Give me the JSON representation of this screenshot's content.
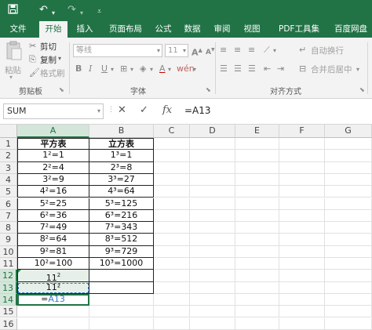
{
  "title_bar": {
    "save_icon": "save-icon",
    "undo_icon": "undo-icon",
    "redo_icon": "redo-icon",
    "qat_icon": "customize-quick-access-icon",
    "color": "#217346"
  },
  "tabs": [
    "文件",
    "开始",
    "插入",
    "页面布局",
    "公式",
    "数据",
    "审阅",
    "视图",
    "PDF工具集",
    "百度网盘"
  ],
  "ribbon": {
    "paste_label": "粘贴",
    "cut_label": "剪切",
    "copy_label": "复制",
    "format_painter_label": "格式刷",
    "clipboard_group": "剪贴板",
    "font_name": "等线",
    "font_size": "11",
    "font_group": "字体",
    "wrap_text_label": "自动换行",
    "merge_center_label": "合并后居中",
    "alignment_group": "对齐方式"
  },
  "formula_bar": {
    "name_box": "SUM",
    "cancel_icon": "✕",
    "enter_icon": "✓",
    "fx_label": "fx",
    "formula": "=A13"
  },
  "columns": [
    "A",
    "B",
    "C",
    "D",
    "E",
    "F",
    "G"
  ],
  "rows": [
    "1",
    "2",
    "3",
    "4",
    "5",
    "6",
    "7",
    "8",
    "9",
    "10",
    "11",
    "12",
    "13",
    "14",
    "15",
    "16"
  ],
  "cells": {
    "A": [
      "平方表",
      "1²=1",
      "2²=4",
      "3²=9",
      "4²=16",
      "5²=25",
      "6²=36",
      "7²=49",
      "8²=64",
      "9²=81",
      "10²=100",
      "11",
      "11²",
      "=",
      "",
      ""
    ],
    "B": [
      "立方表",
      "1³=1",
      "2³=8",
      "3³=27",
      "4³=64",
      "5³=125",
      "6³=216",
      "7³=343",
      "8³=512",
      "9³=729",
      "10³=1000",
      "",
      "",
      "",
      "",
      ""
    ],
    "A12_superscript": "2",
    "A14_reference": "A13"
  },
  "accent_color": "#217346"
}
